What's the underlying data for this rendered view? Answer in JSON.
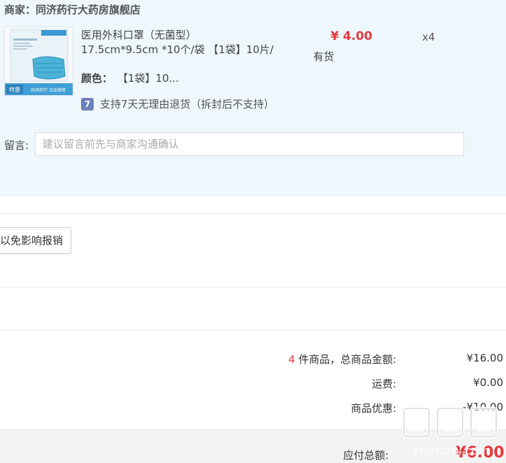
{
  "shop": {
    "merchant_prefix": "商家：",
    "merchant_name": "同济药行大药房旗舰店"
  },
  "item": {
    "name": "医用外科口罩（无菌型）",
    "spec": "17.5cm*9.5cm *10个/袋 【1袋】10片/",
    "price": "¥ 4.00",
    "quantity": "x4",
    "stock": "有货",
    "color_label": "颜色：",
    "color_value": "【1袋】10...",
    "return_icon": "7",
    "return_policy": "支持7天无理由退货（拆封后不支持）",
    "thumbnail_badge": "特惠",
    "thumbnail_caption": "同济药行 正品保障"
  },
  "remark": {
    "label": "留言:",
    "placeholder": "建议留言前先与商家沟通确认"
  },
  "invoice": {
    "button_label": "以免影响报销"
  },
  "summary": {
    "count": "4",
    "count_suffix": "件商品，总商品金额:",
    "subtotal": "¥16.00",
    "shipping_label": "运费:",
    "shipping": "¥0.00",
    "discount_label": "商品优惠:",
    "discount": "-¥10.00",
    "total_label": "应付总额:",
    "total": "¥6.00"
  },
  "watermark": {
    "text": "zhizhizhi.com"
  },
  "colors": {
    "accent_red": "#e4393c",
    "panel_bg": "#eef7fb",
    "icon_purple": "#6c7fb8"
  }
}
